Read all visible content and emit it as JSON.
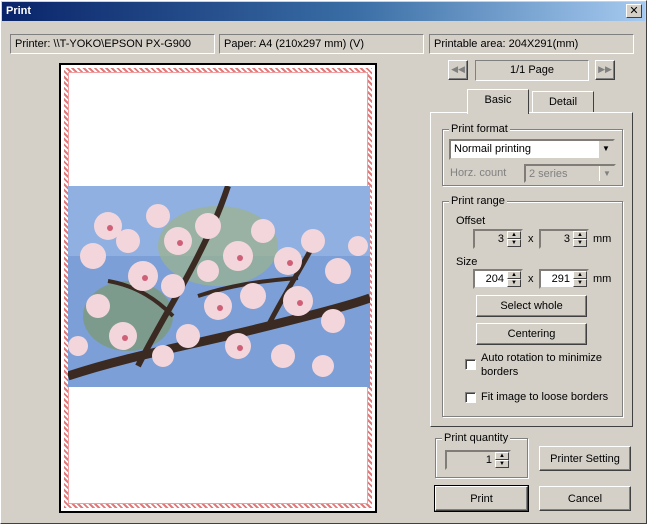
{
  "window": {
    "title": "Print",
    "close_glyph": "✕"
  },
  "info_bar": {
    "printer": "Printer: \\\\T-YOKO\\EPSON PX-G900",
    "paper": "Paper: A4 (210x297 mm) (V)",
    "printable_area": "Printable area: 204X291(mm)"
  },
  "paging": {
    "prev_glyph": "◀◀",
    "next_glyph": "▶▶",
    "page_label": "1/1 Page"
  },
  "tabs": [
    {
      "label": "Basic",
      "active": true
    },
    {
      "label": "Detail",
      "active": false
    }
  ],
  "print_format": {
    "group_label": "Print format",
    "selected": "Normail printing",
    "horz_count_label": "Horz. count",
    "horz_count_value": "2 series"
  },
  "print_range": {
    "group_label": "Print range",
    "offset_label": "Offset",
    "offset_x": "3",
    "offset_y": "3",
    "size_label": "Size",
    "size_w": "204",
    "size_h": "291",
    "times_glyph": "x",
    "unit": "mm",
    "select_whole_label": "Select whole",
    "centering_label": "Centering",
    "auto_rotation_label_line1": "Auto rotation to minimize",
    "auto_rotation_label_line2": "borders",
    "auto_rotation_checked": false,
    "fit_image_label": "Fit image to loose borders",
    "fit_image_checked": false
  },
  "print_quantity": {
    "group_label": "Print quantity",
    "value": "1"
  },
  "buttons": {
    "printer_setting": "Printer Setting",
    "print": "Print",
    "cancel": "Cancel"
  },
  "icons": {
    "dropdown": "▼",
    "spin_up": "▲",
    "spin_down": "▼"
  }
}
